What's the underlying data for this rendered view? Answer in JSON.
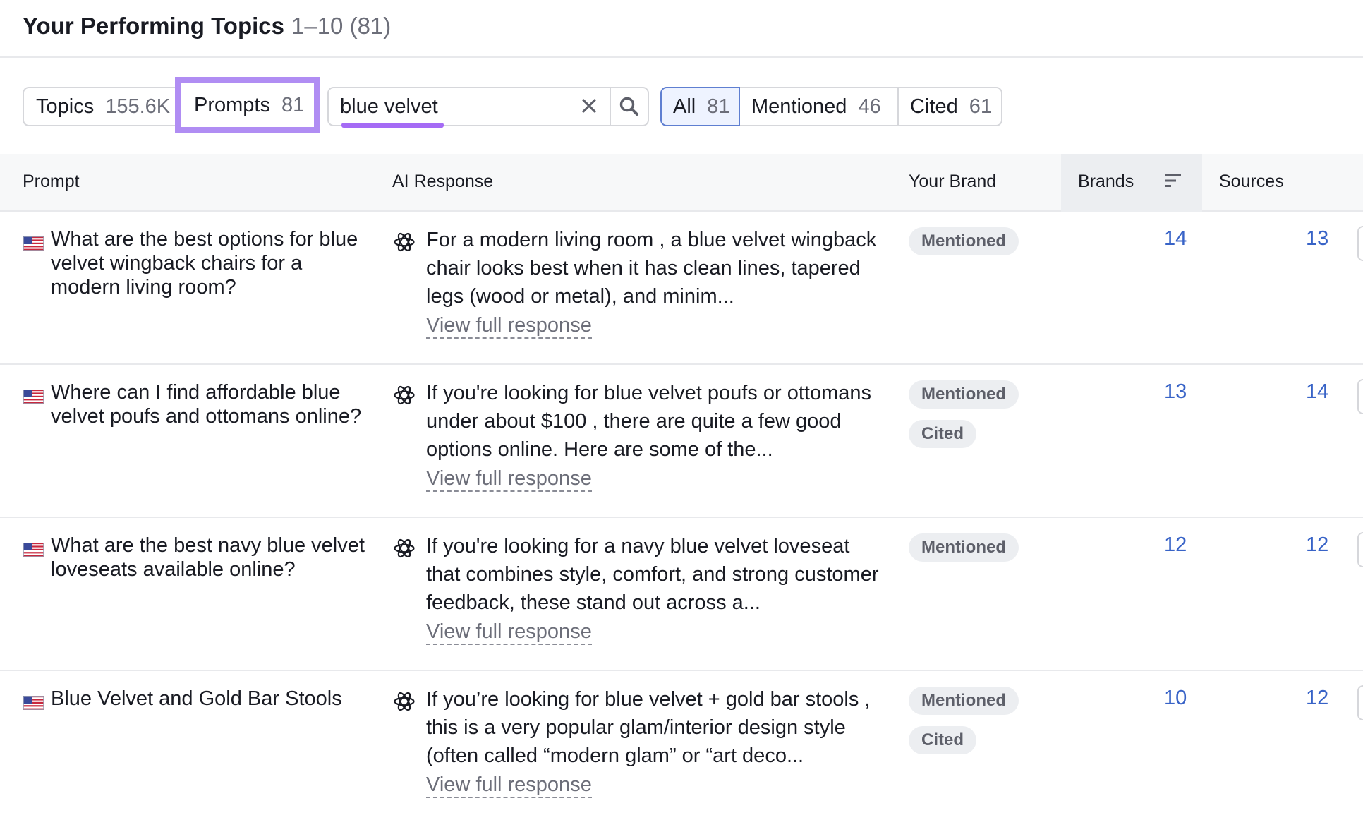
{
  "header": {
    "title": "Your Performing Topics",
    "range": "1–10 (81)"
  },
  "tabs": {
    "topics": {
      "label": "Topics",
      "count": "155.6K"
    },
    "prompts": {
      "label": "Prompts",
      "count": "81"
    }
  },
  "search": {
    "value": "blue velvet"
  },
  "filters": {
    "all": {
      "label": "All",
      "count": "81"
    },
    "mentioned": {
      "label": "Mentioned",
      "count": "46"
    },
    "cited": {
      "label": "Cited",
      "count": "61"
    }
  },
  "table": {
    "columns": {
      "prompt": "Prompt",
      "ai_response": "AI Response",
      "your_brand": "Your Brand",
      "brands": "Brands",
      "sources": "Sources"
    },
    "view_full_label": "View full response",
    "rows": [
      {
        "prompt": "What are the best options for blue velvet wingback chairs for a modern living room?",
        "response": "For a modern living room , a blue velvet wingback chair looks best when it has clean lines, tapered legs (wood or metal), and minim...",
        "badges": [
          "Mentioned"
        ],
        "brands": "14",
        "sources": "13"
      },
      {
        "prompt": "Where can I find affordable blue velvet poufs and ottomans online?",
        "response": "If you're looking for blue velvet poufs or ottomans under about $100 , there are quite a few good options online. Here are some of the...",
        "badges": [
          "Mentioned",
          "Cited"
        ],
        "brands": "13",
        "sources": "14"
      },
      {
        "prompt": "What are the best navy blue velvet loveseats available online?",
        "response": "If you're looking for a navy blue velvet loveseat that combines style, comfort, and strong customer feedback, these stand out across a...",
        "badges": [
          "Mentioned"
        ],
        "brands": "12",
        "sources": "12"
      },
      {
        "prompt": "Blue Velvet and Gold Bar Stools",
        "response": "If you’re looking for blue velvet + gold bar stools , this is a very popular glam/interior design style (often called “modern glam” or “art deco...",
        "badges": [
          "Mentioned",
          "Cited"
        ],
        "brands": "10",
        "sources": "12"
      }
    ]
  },
  "colors": {
    "highlight": "#b08df3",
    "accent_link": "#3863c7",
    "active_filter_border": "#5f7fd1"
  }
}
